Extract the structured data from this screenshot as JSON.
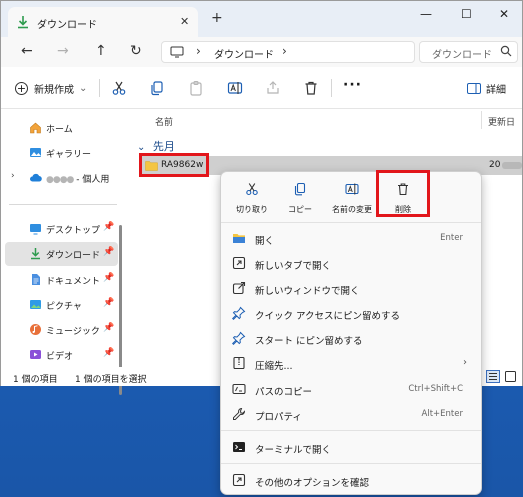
{
  "tab": {
    "title": "ダウンロード",
    "close": "✕",
    "new_tab": "+"
  },
  "window_controls": {
    "minimize": "—",
    "maximize": "☐",
    "close": "✕"
  },
  "nav": {
    "back": "←",
    "forward": "→",
    "up": "↑",
    "refresh": "↻"
  },
  "address": {
    "sep": "›",
    "crumb": "ダウンロード"
  },
  "search": {
    "placeholder": "ダウンロード"
  },
  "toolbar": {
    "new_label": "新規作成",
    "new_chevron": "⌄",
    "more": "···",
    "details_label": "詳細"
  },
  "sidebar": {
    "items": [
      {
        "label": "ホーム"
      },
      {
        "label": "ギャラリー"
      },
      {
        "label": "- 個人用",
        "blurred_prefix": "●●●●"
      },
      {
        "label": "デスクトップ"
      },
      {
        "label": "ダウンロード"
      },
      {
        "label": "ドキュメント"
      },
      {
        "label": "ピクチャ"
      },
      {
        "label": "ミュージック"
      },
      {
        "label": "ビデオ"
      }
    ],
    "pin": "📌",
    "expand": "›"
  },
  "columns": {
    "name": "名前",
    "date": "更新日"
  },
  "group": {
    "label": "先月",
    "chevron": "⌄"
  },
  "file": {
    "name": "RA9862w",
    "date_prefix": "20"
  },
  "status": {
    "count": "1 個の項目",
    "selected": "1 個の項目を選択"
  },
  "context_menu": {
    "quick_actions": [
      {
        "label": "切り取り",
        "icon": "scissors-icon"
      },
      {
        "label": "コピー",
        "icon": "copy-icon"
      },
      {
        "label": "名前の変更",
        "icon": "rename-icon"
      },
      {
        "label": "削除",
        "icon": "trash-icon"
      }
    ],
    "items": [
      {
        "label": "開く",
        "shortcut": "Enter"
      },
      {
        "label": "新しいタブで開く",
        "shortcut": ""
      },
      {
        "label": "新しいウィンドウで開く",
        "shortcut": ""
      },
      {
        "label": "クイック アクセスにピン留めする",
        "shortcut": ""
      },
      {
        "label": "スタート にピン留めする",
        "shortcut": ""
      },
      {
        "label": "圧縮先...",
        "shortcut": "›"
      },
      {
        "label": "パスのコピー",
        "shortcut": "Ctrl+Shift+C"
      },
      {
        "label": "プロパティ",
        "shortcut": "Alt+Enter"
      },
      {
        "label": "ターミナルで開く",
        "shortcut": ""
      },
      {
        "label": "その他のオプションを確認",
        "shortcut": ""
      }
    ]
  },
  "colors": {
    "accent": "#1a4a8a",
    "highlight": "#e2161b",
    "folder": "#f4c542",
    "download_green": "#2e9b4e"
  }
}
